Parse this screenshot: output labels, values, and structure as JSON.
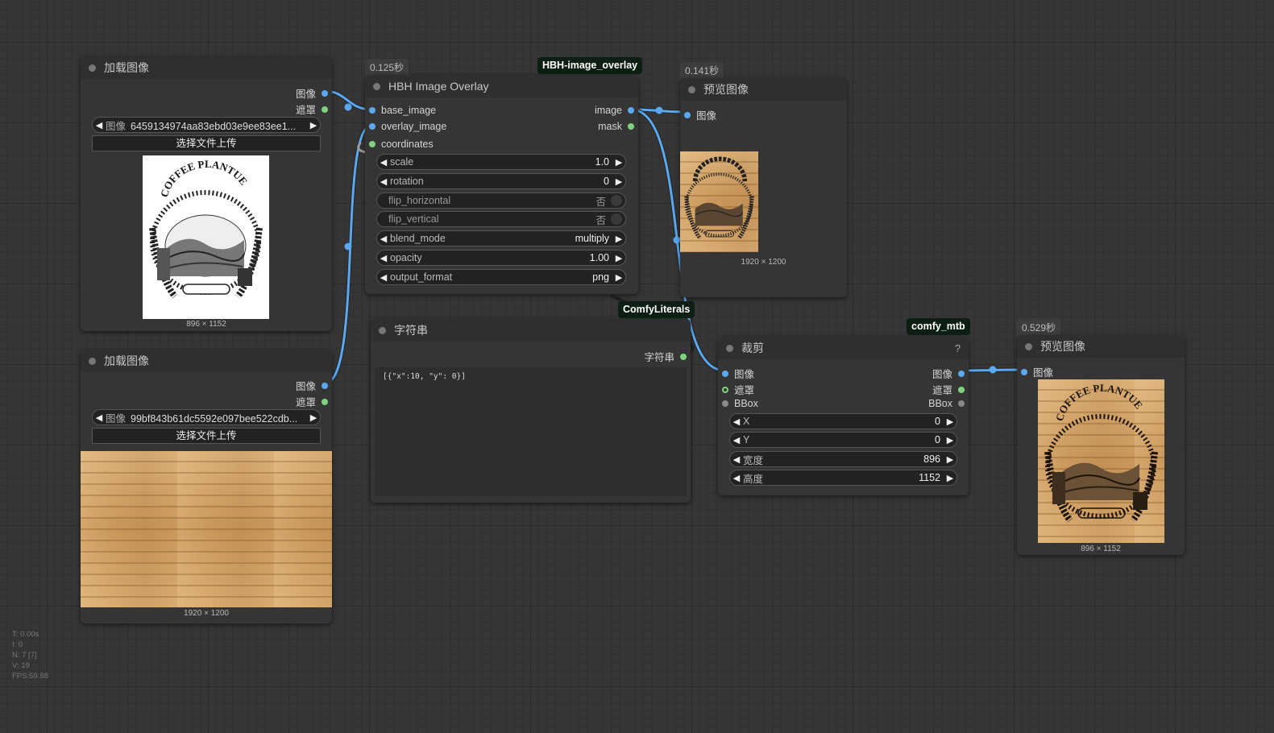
{
  "badges": {
    "overlay_time": "0.125秒",
    "preview1_time": "0.141秒",
    "preview2_time": "0.529秒"
  },
  "tags": {
    "hbh": "HBH-image_overlay",
    "literals": "ComfyLiterals",
    "mtb": "comfy_mtb"
  },
  "load1": {
    "title": "加载图像",
    "out_image": "图像",
    "out_mask": "遮罩",
    "combo_label": "图像",
    "combo_value": "6459134974aa83ebd03e9ee83ee1...",
    "upload": "选择文件上传",
    "image_logo_text": "COFFEE PLANTUE",
    "dims": "896 × 1152"
  },
  "load2": {
    "title": "加载图像",
    "out_image": "图像",
    "out_mask": "遮罩",
    "combo_label": "图像",
    "combo_value": "99bf843b61dc5592e097bee522cdb...",
    "upload": "选择文件上传",
    "dims": "1920 × 1200"
  },
  "overlay": {
    "title": "HBH Image Overlay",
    "in_base": "base_image",
    "in_overlay": "overlay_image",
    "in_coords": "coordinates",
    "out_image": "image",
    "out_mask": "mask",
    "widgets": [
      {
        "label": "scale",
        "value": "1.0"
      },
      {
        "label": "rotation",
        "value": "0"
      },
      {
        "label": "flip_horizontal",
        "value": "否"
      },
      {
        "label": "flip_vertical",
        "value": "否"
      },
      {
        "label": "blend_mode",
        "value": "multiply"
      },
      {
        "label": "opacity",
        "value": "1.00"
      },
      {
        "label": "output_format",
        "value": "png"
      }
    ]
  },
  "preview1": {
    "title": "预览图像",
    "in_image": "图像",
    "dims": "1920 × 1200"
  },
  "string_node": {
    "title": "字符串",
    "out_label": "字符串",
    "text": "[{\"x\":10, \"y\": 0}]"
  },
  "crop": {
    "title": "裁剪",
    "help": "?",
    "in_image": "图像",
    "in_mask": "遮罩",
    "in_bbox": "BBox",
    "out_image": "图像",
    "out_mask": "遮罩",
    "out_bbox": "BBox",
    "widgets": [
      {
        "label": "X",
        "value": "0"
      },
      {
        "label": "Y",
        "value": "0"
      },
      {
        "label": "宽度",
        "value": "896"
      },
      {
        "label": "高度",
        "value": "1152"
      }
    ]
  },
  "preview2": {
    "title": "预览图像",
    "in_image": "图像",
    "image_logo_text": "COFFEE PLANTUE",
    "dims": "896 × 1152"
  },
  "stats": {
    "t": "T: 0.00s",
    "i": "I: 0",
    "n": "N: 7 [7]",
    "v": "V: 19",
    "fps": "FPS:59.88"
  },
  "colors": {
    "link_image": "#5aa8f0",
    "link_mask": "#7ed47e",
    "canvas_bg": "#363636",
    "node_bg": "#353535"
  }
}
